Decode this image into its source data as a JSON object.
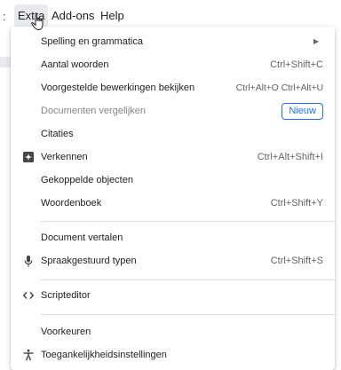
{
  "menubar": {
    "lead": ":",
    "items": [
      {
        "label": "Extra"
      },
      {
        "label": "Add-ons"
      },
      {
        "label": "Help"
      }
    ]
  },
  "menu": {
    "items": [
      {
        "label": "Spelling en grammatica",
        "submenu": true
      },
      {
        "label": "Aantal woorden",
        "shortcut": "Ctrl+Shift+C"
      },
      {
        "label": "Voorgestelde bewerkingen bekijken",
        "shortcut": "Ctrl+Alt+O Ctrl+Alt+U"
      },
      {
        "label": "Documenten vergelijken",
        "badge": "Nieuw",
        "disabled": true
      },
      {
        "label": "Citaties"
      },
      {
        "label": "Verkennen",
        "shortcut": "Ctrl+Alt+Shift+I",
        "icon": "explore-icon"
      },
      {
        "label": "Gekoppelde objecten"
      },
      {
        "label": "Woordenboek",
        "shortcut": "Ctrl+Shift+Y"
      },
      {
        "label": "Document vertalen"
      },
      {
        "label": "Spraakgestuurd typen",
        "shortcut": "Ctrl+Shift+S",
        "icon": "microphone-icon"
      },
      {
        "label": "Scripteditor",
        "icon": "code-icon"
      },
      {
        "label": "Voorkeuren"
      },
      {
        "label": "Toegankelijkheidsinstellingen",
        "icon": "accessibility-icon"
      }
    ]
  },
  "colors": {
    "accent": "#1a73e8",
    "text": "#202124",
    "muted": "#5f6368",
    "disabled": "#80868b",
    "separator": "#dadce0"
  }
}
